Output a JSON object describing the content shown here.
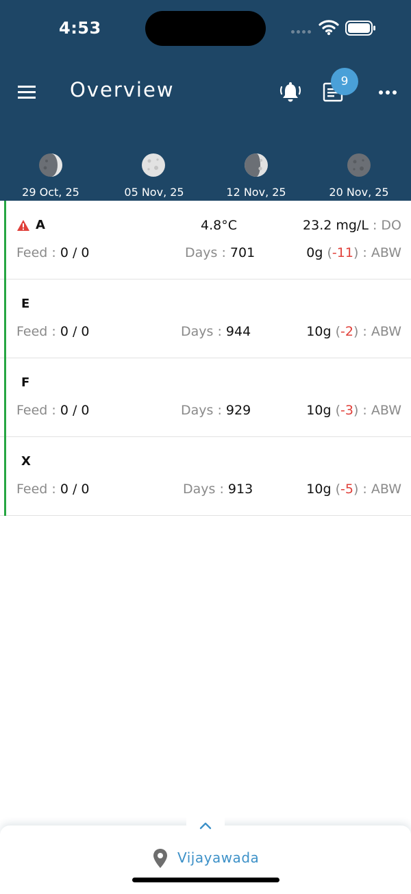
{
  "status_bar": {
    "time": "4:53"
  },
  "header": {
    "title": "Overview",
    "notification_count": "9"
  },
  "moon_phases": [
    {
      "date": "29 Oct, 25",
      "phase": "waning-crescent"
    },
    {
      "date": "05 Nov, 25",
      "phase": "full-moon"
    },
    {
      "date": "12 Nov, 25",
      "phase": "waning-gibbous"
    },
    {
      "date": "20 Nov, 25",
      "phase": "new-moon"
    }
  ],
  "ponds": [
    {
      "name": "A",
      "alert": true,
      "temperature": "4.8°C",
      "do_value": "23.2 mg/L",
      "do_label": ": DO",
      "feed_label": "Feed :",
      "feed_value": "0 / 0",
      "days_label": "Days :",
      "days_value": "701",
      "abw_value": "0g",
      "abw_delta": "-11",
      "abw_label": ": ABW"
    },
    {
      "name": "E",
      "alert": false,
      "feed_label": "Feed :",
      "feed_value": "0 / 0",
      "days_label": "Days :",
      "days_value": "944",
      "abw_value": "10g",
      "abw_delta": "-2",
      "abw_label": ": ABW"
    },
    {
      "name": "F",
      "alert": false,
      "feed_label": "Feed :",
      "feed_value": "0 / 0",
      "days_label": "Days :",
      "days_value": "929",
      "abw_value": "10g",
      "abw_delta": "-3",
      "abw_label": ": ABW"
    },
    {
      "name": "X",
      "alert": false,
      "feed_label": "Feed :",
      "feed_value": "0 / 0",
      "days_label": "Days :",
      "days_value": "913",
      "abw_value": "10g",
      "abw_delta": "-5",
      "abw_label": ": ABW"
    }
  ],
  "bottom_bar": {
    "location": "Vijayawada"
  },
  "colors": {
    "header_bg": "#1e4666",
    "badge": "#4aa0d8",
    "active_bar": "#26a642",
    "negative": "#e0403a",
    "location": "#3d91c8"
  },
  "icons": [
    "menu-icon",
    "bell-icon",
    "report-icon",
    "more-icon",
    "warning-icon",
    "chevron-up-icon",
    "location-pin-icon",
    "wifi-icon",
    "battery-icon"
  ]
}
